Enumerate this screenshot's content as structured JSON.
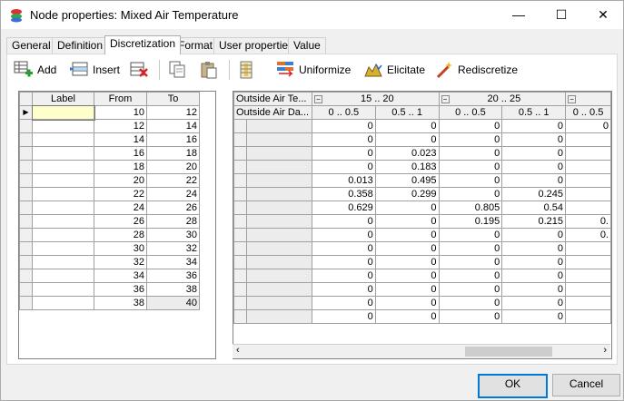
{
  "window": {
    "title": "Node properties: Mixed Air Temperature"
  },
  "tabs": [
    "General",
    "Definition",
    "Discretization",
    "Format",
    "User properties",
    "Value"
  ],
  "toolbar": {
    "add": "Add",
    "insert": "Insert",
    "uniformize": "Uniformize",
    "elicitate": "Elicitate",
    "rediscretize": "Rediscretize"
  },
  "left_table": {
    "headers": [
      "Label",
      "From",
      "To"
    ],
    "rows": [
      [
        "",
        "10",
        "12"
      ],
      [
        "",
        "12",
        "14"
      ],
      [
        "",
        "14",
        "16"
      ],
      [
        "",
        "16",
        "18"
      ],
      [
        "",
        "18",
        "20"
      ],
      [
        "",
        "20",
        "22"
      ],
      [
        "",
        "22",
        "24"
      ],
      [
        "",
        "24",
        "26"
      ],
      [
        "",
        "26",
        "28"
      ],
      [
        "",
        "28",
        "30"
      ],
      [
        "",
        "30",
        "32"
      ],
      [
        "",
        "32",
        "34"
      ],
      [
        "",
        "34",
        "36"
      ],
      [
        "",
        "36",
        "38"
      ],
      [
        "",
        "38",
        "40"
      ]
    ]
  },
  "right_table": {
    "parent1": "Outside Air Te...",
    "parent2": "Outside Air Da...",
    "groups": [
      "15 .. 20",
      "20 .. 25",
      ""
    ],
    "sub": [
      "0 .. 0.5",
      "0.5 .. 1",
      "0 .. 0.5",
      "0.5 .. 1",
      "0 .. 0.5"
    ],
    "rows": [
      [
        "0",
        "0",
        "0",
        "0",
        "0"
      ],
      [
        "0",
        "0",
        "0",
        "0",
        ""
      ],
      [
        "0",
        "0.023",
        "0",
        "0",
        ""
      ],
      [
        "0",
        "0.183",
        "0",
        "0",
        ""
      ],
      [
        "0.013",
        "0.495",
        "0",
        "0",
        ""
      ],
      [
        "0.358",
        "0.299",
        "0",
        "0.245",
        ""
      ],
      [
        "0.629",
        "0",
        "0.805",
        "0.54",
        ""
      ],
      [
        "0",
        "0",
        "0.195",
        "0.215",
        "0."
      ],
      [
        "0",
        "0",
        "0",
        "0",
        "0."
      ],
      [
        "0",
        "0",
        "0",
        "0",
        ""
      ],
      [
        "0",
        "0",
        "0",
        "0",
        ""
      ],
      [
        "0",
        "0",
        "0",
        "0",
        ""
      ],
      [
        "0",
        "0",
        "0",
        "0",
        ""
      ],
      [
        "0",
        "0",
        "0",
        "0",
        ""
      ],
      [
        "0",
        "0",
        "0",
        "0",
        ""
      ]
    ]
  },
  "buttons": {
    "ok": "OK",
    "cancel": "Cancel"
  }
}
